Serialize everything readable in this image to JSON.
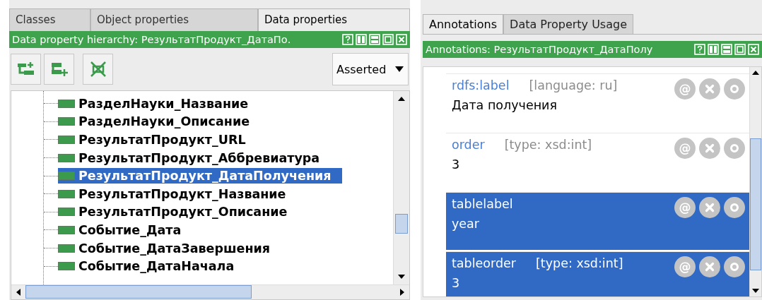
{
  "left_tabs": [
    {
      "label": "Classes",
      "selected": false
    },
    {
      "label": "Object properties",
      "selected": false
    },
    {
      "label": "Data properties",
      "selected": true
    }
  ],
  "hierarchy_header": {
    "title": "Data property hierarchy: РезультатПродукт_ДатаПо."
  },
  "toolbar": {
    "view_dropdown": "Asserted"
  },
  "tree": [
    {
      "label": "РазделНауки_Название",
      "selected": false
    },
    {
      "label": "РазделНауки_Описание",
      "selected": false
    },
    {
      "label": "РезультатПродукт_URL",
      "selected": false
    },
    {
      "label": "РезультатПродукт_Аббревиатура",
      "selected": false
    },
    {
      "label": "РезультатПродукт_ДатаПолучения",
      "selected": true
    },
    {
      "label": "РезультатПродукт_Название",
      "selected": false
    },
    {
      "label": "РезультатПродукт_Описание",
      "selected": false
    },
    {
      "label": "Событие_Дата",
      "selected": false
    },
    {
      "label": "Событие_ДатаЗавершения",
      "selected": false
    },
    {
      "label": "Событие_ДатаНачала",
      "selected": false
    }
  ],
  "right_tabs": [
    {
      "label": "Annotations",
      "selected": true
    },
    {
      "label": "Data Property Usage",
      "selected": false
    }
  ],
  "annotations_header": {
    "title": "Annotations: РезультатПродукт_ДатаПолу"
  },
  "annotations": [
    {
      "property": "rdfs:label",
      "qualifier": "[language: ru]",
      "value": "Дата получения",
      "selected": false,
      "at_button": "@"
    },
    {
      "property": "order",
      "qualifier": "[type: xsd:int]",
      "value": "3",
      "selected": false,
      "at_button": "@"
    },
    {
      "property": "tablelabel",
      "value": "year",
      "selected": true,
      "at_button": "@"
    },
    {
      "property": "tableorder",
      "qualifier": "[type: xsd:int]",
      "value": "3",
      "selected": true,
      "at_button": "@"
    }
  ]
}
